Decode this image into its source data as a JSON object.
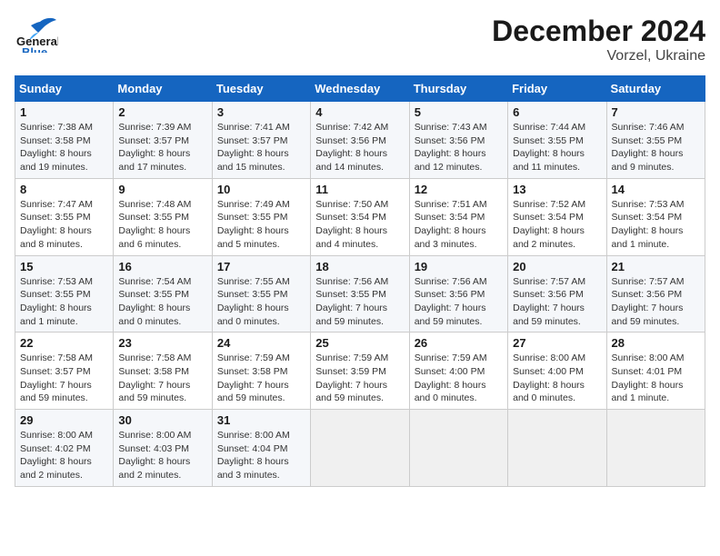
{
  "header": {
    "logo_line1": "General",
    "logo_line2": "Blue",
    "title": "December 2024",
    "subtitle": "Vorzel, Ukraine"
  },
  "weekdays": [
    "Sunday",
    "Monday",
    "Tuesday",
    "Wednesday",
    "Thursday",
    "Friday",
    "Saturday"
  ],
  "weeks": [
    [
      {
        "day": "1",
        "sunrise": "Sunrise: 7:38 AM",
        "sunset": "Sunset: 3:58 PM",
        "daylight": "Daylight: 8 hours and 19 minutes."
      },
      {
        "day": "2",
        "sunrise": "Sunrise: 7:39 AM",
        "sunset": "Sunset: 3:57 PM",
        "daylight": "Daylight: 8 hours and 17 minutes."
      },
      {
        "day": "3",
        "sunrise": "Sunrise: 7:41 AM",
        "sunset": "Sunset: 3:57 PM",
        "daylight": "Daylight: 8 hours and 15 minutes."
      },
      {
        "day": "4",
        "sunrise": "Sunrise: 7:42 AM",
        "sunset": "Sunset: 3:56 PM",
        "daylight": "Daylight: 8 hours and 14 minutes."
      },
      {
        "day": "5",
        "sunrise": "Sunrise: 7:43 AM",
        "sunset": "Sunset: 3:56 PM",
        "daylight": "Daylight: 8 hours and 12 minutes."
      },
      {
        "day": "6",
        "sunrise": "Sunrise: 7:44 AM",
        "sunset": "Sunset: 3:55 PM",
        "daylight": "Daylight: 8 hours and 11 minutes."
      },
      {
        "day": "7",
        "sunrise": "Sunrise: 7:46 AM",
        "sunset": "Sunset: 3:55 PM",
        "daylight": "Daylight: 8 hours and 9 minutes."
      }
    ],
    [
      {
        "day": "8",
        "sunrise": "Sunrise: 7:47 AM",
        "sunset": "Sunset: 3:55 PM",
        "daylight": "Daylight: 8 hours and 8 minutes."
      },
      {
        "day": "9",
        "sunrise": "Sunrise: 7:48 AM",
        "sunset": "Sunset: 3:55 PM",
        "daylight": "Daylight: 8 hours and 6 minutes."
      },
      {
        "day": "10",
        "sunrise": "Sunrise: 7:49 AM",
        "sunset": "Sunset: 3:55 PM",
        "daylight": "Daylight: 8 hours and 5 minutes."
      },
      {
        "day": "11",
        "sunrise": "Sunrise: 7:50 AM",
        "sunset": "Sunset: 3:54 PM",
        "daylight": "Daylight: 8 hours and 4 minutes."
      },
      {
        "day": "12",
        "sunrise": "Sunrise: 7:51 AM",
        "sunset": "Sunset: 3:54 PM",
        "daylight": "Daylight: 8 hours and 3 minutes."
      },
      {
        "day": "13",
        "sunrise": "Sunrise: 7:52 AM",
        "sunset": "Sunset: 3:54 PM",
        "daylight": "Daylight: 8 hours and 2 minutes."
      },
      {
        "day": "14",
        "sunrise": "Sunrise: 7:53 AM",
        "sunset": "Sunset: 3:54 PM",
        "daylight": "Daylight: 8 hours and 1 minute."
      }
    ],
    [
      {
        "day": "15",
        "sunrise": "Sunrise: 7:53 AM",
        "sunset": "Sunset: 3:55 PM",
        "daylight": "Daylight: 8 hours and 1 minute."
      },
      {
        "day": "16",
        "sunrise": "Sunrise: 7:54 AM",
        "sunset": "Sunset: 3:55 PM",
        "daylight": "Daylight: 8 hours and 0 minutes."
      },
      {
        "day": "17",
        "sunrise": "Sunrise: 7:55 AM",
        "sunset": "Sunset: 3:55 PM",
        "daylight": "Daylight: 8 hours and 0 minutes."
      },
      {
        "day": "18",
        "sunrise": "Sunrise: 7:56 AM",
        "sunset": "Sunset: 3:55 PM",
        "daylight": "Daylight: 7 hours and 59 minutes."
      },
      {
        "day": "19",
        "sunrise": "Sunrise: 7:56 AM",
        "sunset": "Sunset: 3:56 PM",
        "daylight": "Daylight: 7 hours and 59 minutes."
      },
      {
        "day": "20",
        "sunrise": "Sunrise: 7:57 AM",
        "sunset": "Sunset: 3:56 PM",
        "daylight": "Daylight: 7 hours and 59 minutes."
      },
      {
        "day": "21",
        "sunrise": "Sunrise: 7:57 AM",
        "sunset": "Sunset: 3:56 PM",
        "daylight": "Daylight: 7 hours and 59 minutes."
      }
    ],
    [
      {
        "day": "22",
        "sunrise": "Sunrise: 7:58 AM",
        "sunset": "Sunset: 3:57 PM",
        "daylight": "Daylight: 7 hours and 59 minutes."
      },
      {
        "day": "23",
        "sunrise": "Sunrise: 7:58 AM",
        "sunset": "Sunset: 3:58 PM",
        "daylight": "Daylight: 7 hours and 59 minutes."
      },
      {
        "day": "24",
        "sunrise": "Sunrise: 7:59 AM",
        "sunset": "Sunset: 3:58 PM",
        "daylight": "Daylight: 7 hours and 59 minutes."
      },
      {
        "day": "25",
        "sunrise": "Sunrise: 7:59 AM",
        "sunset": "Sunset: 3:59 PM",
        "daylight": "Daylight: 7 hours and 59 minutes."
      },
      {
        "day": "26",
        "sunrise": "Sunrise: 7:59 AM",
        "sunset": "Sunset: 4:00 PM",
        "daylight": "Daylight: 8 hours and 0 minutes."
      },
      {
        "day": "27",
        "sunrise": "Sunrise: 8:00 AM",
        "sunset": "Sunset: 4:00 PM",
        "daylight": "Daylight: 8 hours and 0 minutes."
      },
      {
        "day": "28",
        "sunrise": "Sunrise: 8:00 AM",
        "sunset": "Sunset: 4:01 PM",
        "daylight": "Daylight: 8 hours and 1 minute."
      }
    ],
    [
      {
        "day": "29",
        "sunrise": "Sunrise: 8:00 AM",
        "sunset": "Sunset: 4:02 PM",
        "daylight": "Daylight: 8 hours and 2 minutes."
      },
      {
        "day": "30",
        "sunrise": "Sunrise: 8:00 AM",
        "sunset": "Sunset: 4:03 PM",
        "daylight": "Daylight: 8 hours and 2 minutes."
      },
      {
        "day": "31",
        "sunrise": "Sunrise: 8:00 AM",
        "sunset": "Sunset: 4:04 PM",
        "daylight": "Daylight: 8 hours and 3 minutes."
      },
      null,
      null,
      null,
      null
    ]
  ]
}
